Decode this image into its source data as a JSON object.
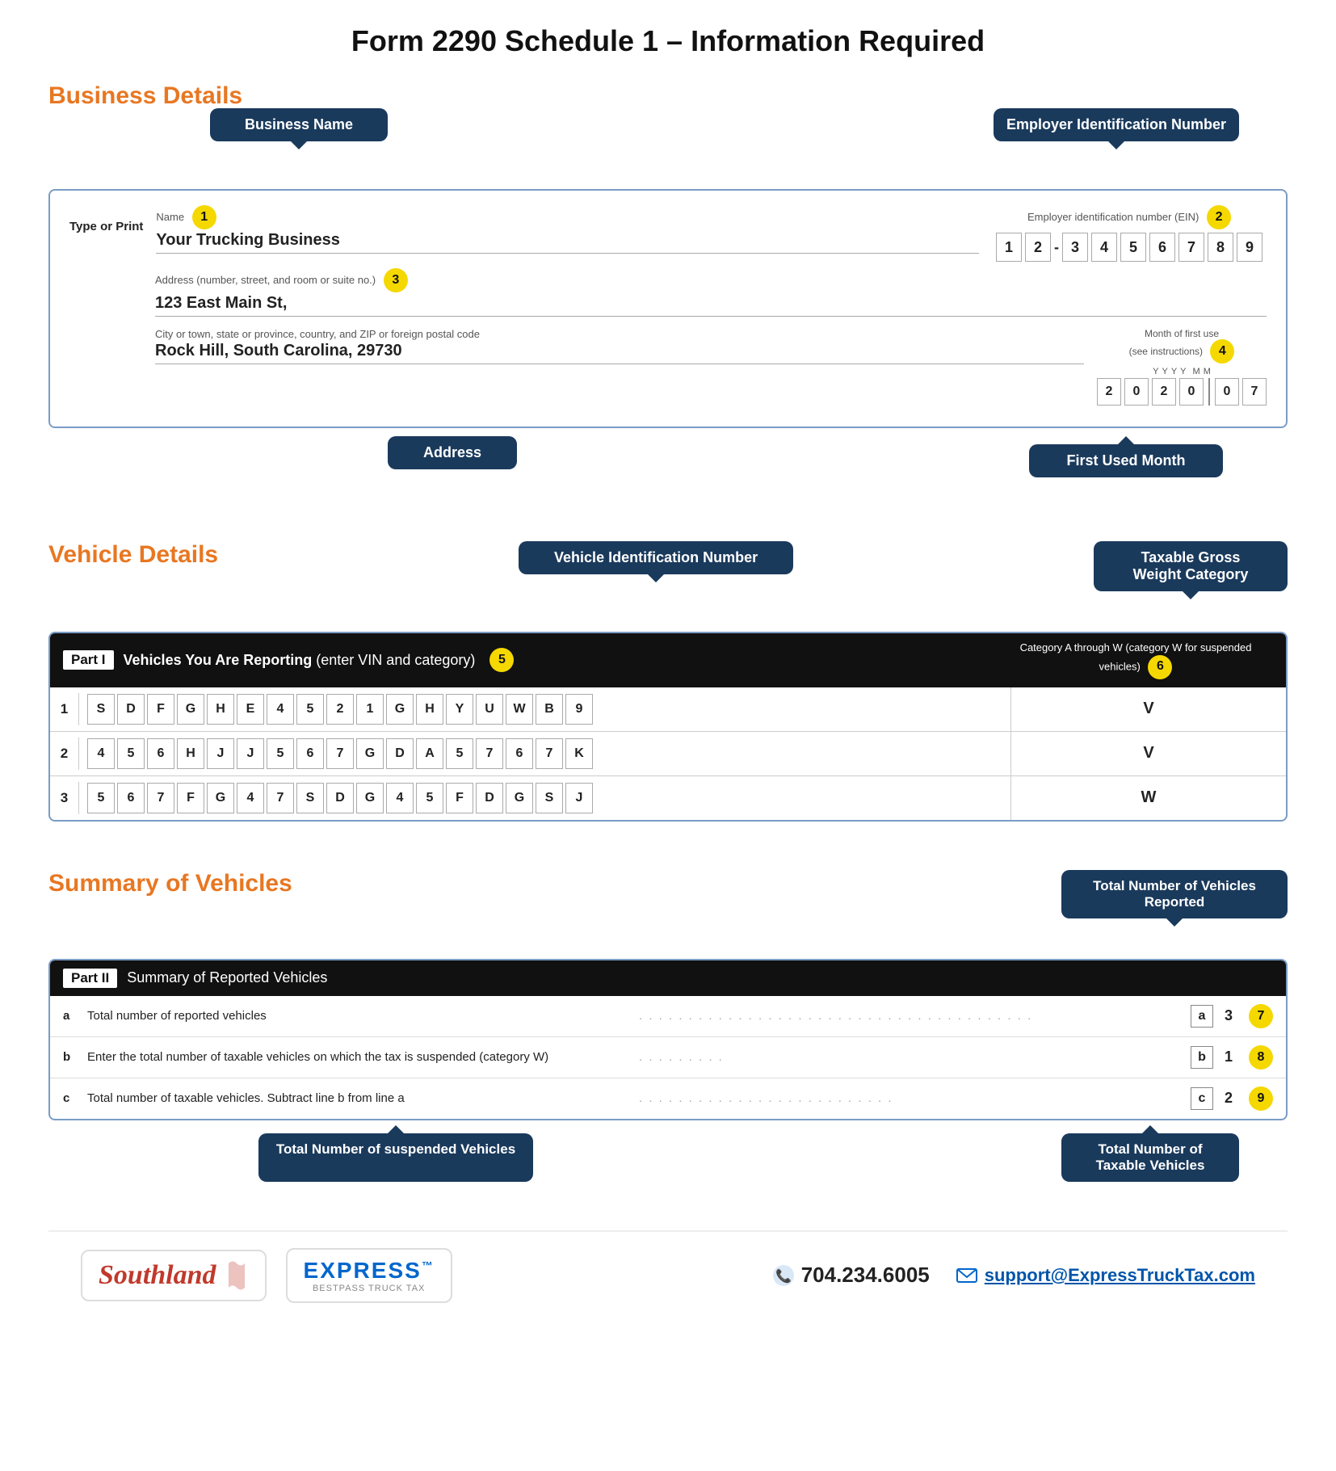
{
  "page": {
    "title": "Form 2290 Schedule 1 – Information Required"
  },
  "business": {
    "section_title": "Business Details",
    "tooltip_business_name": "Business Name",
    "tooltip_ein": "Employer Identification Number",
    "tooltip_address": "Address",
    "tooltip_first_used": "First Used Month",
    "name_label": "Name",
    "name_badge": "1",
    "name_value": "Your Trucking Business",
    "ein_label": "Employer identification number (EIN)",
    "ein_badge": "2",
    "ein_digits": [
      "1",
      "2",
      "3",
      "4",
      "5",
      "6",
      "7",
      "8",
      "9"
    ],
    "address_label": "Address (number, street, and room or suite no.)",
    "address_badge": "3",
    "address_value": "123 East Main St,",
    "city_label": "City or town, state or province, country, and ZIP or foreign postal code",
    "city_value": "Rock Hill, South Carolina, 29730",
    "month_label": "Month of first use\n(see instructions)",
    "month_badge": "4",
    "month_y_labels": [
      "Y",
      "Y",
      "Y",
      "Y",
      "M",
      "M"
    ],
    "month_digits": [
      "2",
      "0",
      "2",
      "0",
      "0",
      "7"
    ],
    "type_or_print": "Type\nor Print"
  },
  "vehicle": {
    "section_title": "Vehicle Details",
    "tooltip_vin": "Vehicle Identification Number",
    "tooltip_category": "Taxable Gross\nWeight Category",
    "part_label": "Part I",
    "header_text": "Vehicles You Are Reporting",
    "header_subtext": "(enter VIN and category)",
    "header_badge": "5",
    "cat_header": "Category A through W\n(category W for\nsuspended vehicles)",
    "cat_badge": "6",
    "rows": [
      {
        "num": "1",
        "vin": [
          "S",
          "D",
          "F",
          "G",
          "H",
          "E",
          "4",
          "5",
          "2",
          "1",
          "G",
          "H",
          "Y",
          "U",
          "W",
          "B",
          "9"
        ],
        "category": "V"
      },
      {
        "num": "2",
        "vin": [
          "4",
          "5",
          "6",
          "H",
          "J",
          "J",
          "5",
          "6",
          "7",
          "G",
          "D",
          "A",
          "5",
          "7",
          "6",
          "7",
          "K"
        ],
        "category": "V"
      },
      {
        "num": "3",
        "vin": [
          "5",
          "6",
          "7",
          "F",
          "G",
          "4",
          "7",
          "S",
          "D",
          "G",
          "4",
          "5",
          "F",
          "D",
          "G",
          "S",
          "J"
        ],
        "category": "W"
      }
    ]
  },
  "summary": {
    "section_title": "Summary of Vehicles",
    "tooltip_total_reported": "Total Number of Vehicles\nReported",
    "tooltip_suspended": "Total Number of suspended Vehicles",
    "tooltip_taxable": "Total Number of\nTaxable Vehicles",
    "part_label": "Part II",
    "header_text": "Summary of Reported Vehicles",
    "rows": [
      {
        "letter": "a",
        "text": "Total number of reported vehicles",
        "result_letter": "a",
        "result_value": "3",
        "badge": "7"
      },
      {
        "letter": "b",
        "text": "Enter the total number of taxable vehicles on which the tax is suspended (category W)",
        "result_letter": "b",
        "result_value": "1",
        "badge": "8"
      },
      {
        "letter": "c",
        "text": "Total number of taxable vehicles. Subtract line b from line a",
        "result_letter": "c",
        "result_value": "2",
        "badge": "9"
      }
    ]
  },
  "footer": {
    "logo_southland": "Southland",
    "logo_express": "EXPRESS™\nBESTPASS TRUCK TAX",
    "phone": "704.234.6005",
    "email": "support@ExpressTruckTax.com"
  }
}
